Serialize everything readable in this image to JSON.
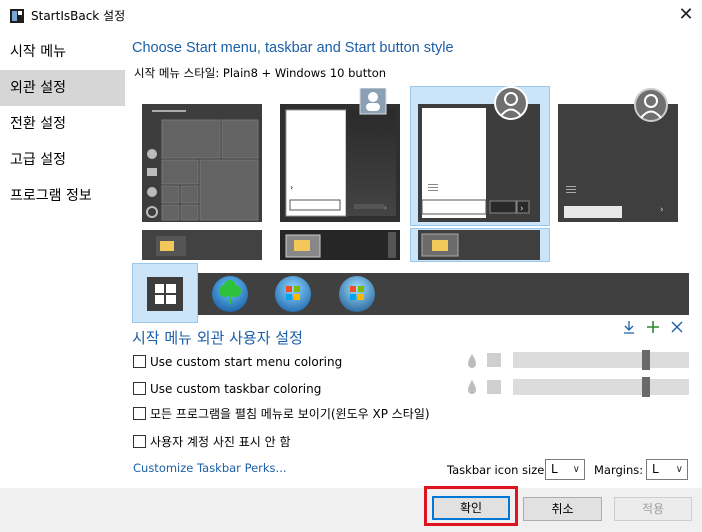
{
  "window": {
    "title": "StartIsBack 설정",
    "close_glyph": "✕"
  },
  "sidebar": {
    "items": [
      {
        "label": "시작 메뉴",
        "active": false
      },
      {
        "label": "외관 설정",
        "active": true
      },
      {
        "label": "전환 설정",
        "active": false
      },
      {
        "label": "고급 설정",
        "active": false
      },
      {
        "label": "프로그램 정보",
        "active": false
      }
    ]
  },
  "main": {
    "heading": "Choose Start menu, taskbar and Start button style",
    "style_label": "시작 메뉴 스타일:",
    "style_value": "Plain8 + Windows 10 button",
    "styles": [
      "Windows 10",
      "Windows 7 dark",
      "Plain8",
      "Plain10"
    ],
    "selected_style": "Plain8",
    "buttons": [
      "Windows 10 button",
      "Clover orb",
      "Windows 7 orb",
      "Windows 7 orb alt"
    ],
    "selected_button": "Windows 10 button"
  },
  "appearance": {
    "heading": "시작 메뉴 외관 사용자 설정",
    "tool_icons": [
      "download-icon",
      "add-icon",
      "remove-icon"
    ],
    "options": [
      {
        "label": "Use custom start menu coloring",
        "checked": false
      },
      {
        "label": "Use custom taskbar coloring",
        "checked": false
      },
      {
        "label": "모든 프로그램을 펼침 메뉴로 보이기(윈도우 XP 스타일)",
        "checked": false
      },
      {
        "label": "사용자 계정 사진 표시 안 함",
        "checked": false
      }
    ],
    "perks_link": "Customize Taskbar Perks...",
    "icon_size_label": "Taskbar icon size:",
    "icon_size_value": "L",
    "margins_label": "Margins:",
    "margins_value": "L"
  },
  "footer": {
    "ok": "확인",
    "cancel": "취소",
    "apply": "적용"
  },
  "colors": {
    "accent": "#1c5fa8",
    "selection": "#cce4f7",
    "highlight_border": "#e0141e"
  }
}
